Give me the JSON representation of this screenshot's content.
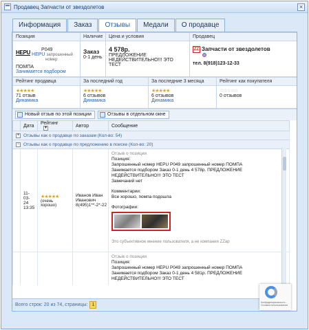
{
  "window": {
    "title": "Продавец Запчасти от звездолетов",
    "close": "×"
  },
  "tabs": [
    "Информация",
    "Заказ",
    "Отзывы",
    "Медали",
    "О продавце"
  ],
  "info": {
    "headers": {
      "position": "Позиция",
      "availability": "Наличие",
      "price_terms": "Цена и условия",
      "seller": "Продавец"
    },
    "part": {
      "brand_logo": "HEPU",
      "code": "P049",
      "brand": "HEPU",
      "desc1": "запрошенный",
      "desc2": "номер",
      "name": "ПОМПА",
      "note": "Занимается подбором"
    },
    "availability": {
      "label": "Заказ",
      "days": "0-1 день"
    },
    "price": {
      "value": "4 578р.",
      "l1": "ПРЕДЛОЖЕНИЕ",
      "l2": "НЕДЕЙСТВИТЕЛЬНО!!! ЭТО ТЕСТ"
    },
    "seller": {
      "logo": "ZZ",
      "name": "Запчасти от звездолетов",
      "phone": "тел. 8(918)123-12-33"
    }
  },
  "ratings": {
    "headers": {
      "seller": "Рейтинг продавца",
      "year": "За последний год",
      "months3": "За последние 3 месяца",
      "buyer": "Рейтинг как покупателя"
    },
    "seller": {
      "stars": "★★★★★",
      "count": "71 отзыв",
      "link": "Динамика"
    },
    "year": {
      "stars": "★★★★★",
      "count": "6 отзывов",
      "link": "Динамика"
    },
    "months3": {
      "stars": "★★★★★",
      "count": "6 отзывов",
      "link": "Динамика"
    },
    "buyer": {
      "stars": "☆☆☆☆☆",
      "count": "0 отзывов"
    }
  },
  "buttons": {
    "new_review": "Новый отзыв по этой позиции",
    "open_window": "Отзывы в отдельном окне"
  },
  "grid": {
    "headers": {
      "date": "Дата",
      "rating": "Рейтинг",
      "author": "Автор",
      "message": "Сообщение"
    },
    "group1": "Отзывы как о продавце по заказам (Кол-во: 54)",
    "group2": "Отзывы как о продавце по предложению в поиске (Кол-во: 20)",
    "review1": {
      "date": "11-03-24",
      "time": "13:35",
      "stars": "★★★★★",
      "rating_label": "(очень хорошо)",
      "author1": "Иванов Иван",
      "author2": "Иванович",
      "author3": "8(495)1**-2*-22",
      "m_source": "Отзыв о позиции",
      "m_pos": "Позиция:",
      "m_line1": "Запрошенный номер HEPU P049 запрошенный номер ПОМПА",
      "m_line2": "Занимается подбором Заказ 0-1 день 4 578р. ПРЕДЛОЖЕНИЕ",
      "m_line3": "НЕДЕЙСТВИТЕЛЬНО!!! ЭТО ТЕСТ",
      "m_line4": "Замечаний нет",
      "m_comments": "Комментарии:",
      "m_comment": "Все хорошо, помпа подошла",
      "m_photos": "Фотографии:",
      "m_disclaimer": "Это субъективное мнение пользователя, а не компании ZZap"
    },
    "review2": {
      "m_source": "Отзыв о позиции",
      "m_pos": "Позиция:",
      "m_line1": "Запрошенный номер HEPU P049 запрошенный номер ПОМПА",
      "m_line2": "Занимается подбором Заказ 0-1 день 4 581р. ПРЕДЛОЖЕНИЕ",
      "m_line3": "НЕДЕЙСТВИТЕЛЬНО!!! ЭТО ТЕСТ"
    }
  },
  "footer": {
    "text": "Всего строк: 20 из 74, страницы:",
    "page": "1"
  },
  "recaptcha": {
    "text1": "Конфиденциальность -",
    "text2": "Условия использования"
  }
}
